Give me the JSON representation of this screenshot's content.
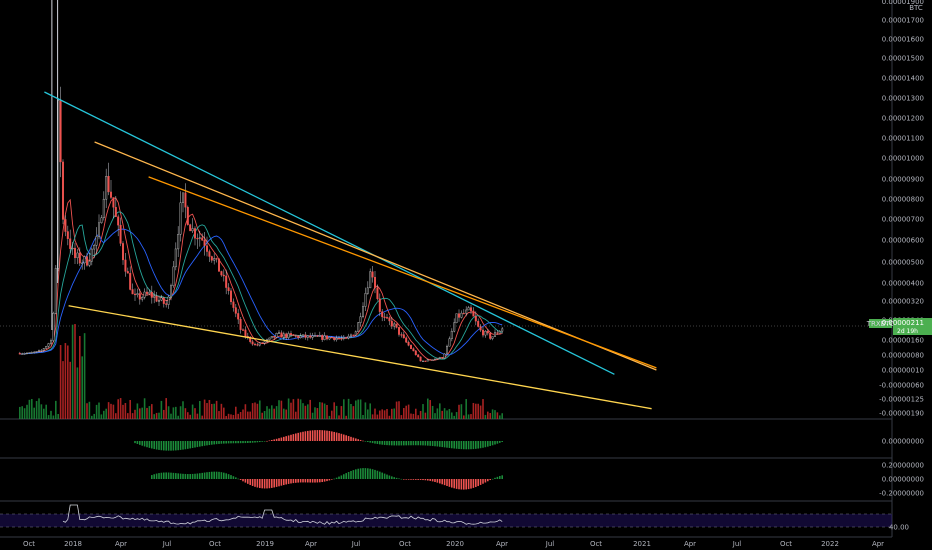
{
  "chart_data": {
    "type": "candlestick",
    "axis_unit": "BTC",
    "price_ticks": [
      "0.00001700",
      "0.00001600",
      "0.00001500",
      "0.00001400",
      "0.00001300",
      "0.00001200",
      "0.00001100",
      "0.00001000",
      "0.00000900",
      "0.00000800",
      "0.00000700",
      "0.00000600",
      "0.00000500",
      "0.00000400",
      "0.00000320",
      "0.00000240",
      "0.00000160",
      "0.00000080",
      "0.00000010",
      "-0.00000060",
      "-0.00000125",
      "-0.00000190"
    ],
    "top_tick_partial": "0.00001900",
    "current_price": {
      "symbol": "TRXBTC",
      "value": "0.00000211",
      "countdown": "2d 19h"
    },
    "osc1_tick": "0.00000000",
    "osc2_ticks": [
      "0.20000000",
      "0.00000000",
      "-0.20000000"
    ],
    "rsi_tick": "40.00",
    "time_labels": [
      "Oct",
      "2018",
      "Apr",
      "Jul",
      "Oct",
      "2019",
      "Apr",
      "Jul",
      "Oct",
      "2020",
      "Apr",
      "Jul",
      "Oct",
      "2021",
      "Apr",
      "Jul",
      "Oct",
      "2022",
      "Apr"
    ],
    "price_series": [
      {
        "t": 0,
        "p": 9e-07
      },
      {
        "t": 0.25,
        "p": 1e-06
      },
      {
        "t": 0.5,
        "p": 1.6e-06
      },
      {
        "t": 0.6,
        "p": 5e-06
      },
      {
        "t": 0.65,
        "p": 1.3e-05
      },
      {
        "t": 0.75,
        "p": 7e-06
      },
      {
        "t": 1.0,
        "p": 5.2e-06
      },
      {
        "t": 1.25,
        "p": 5e-06
      },
      {
        "t": 1.5,
        "p": 6e-06
      },
      {
        "t": 1.65,
        "p": 9e-06
      },
      {
        "t": 1.75,
        "p": 8.5e-06
      },
      {
        "t": 2.0,
        "p": 5.5e-06
      },
      {
        "t": 2.25,
        "p": 3.3e-06
      },
      {
        "t": 2.6,
        "p": 3.5e-06
      },
      {
        "t": 3.0,
        "p": 3e-06
      },
      {
        "t": 3.3,
        "p": 8e-06
      },
      {
        "t": 3.5,
        "p": 6.5e-06
      },
      {
        "t": 3.75,
        "p": 6e-06
      },
      {
        "t": 4.1,
        "p": 4.5e-06
      },
      {
        "t": 4.5,
        "p": 2e-06
      },
      {
        "t": 4.8,
        "p": 1.3e-06
      },
      {
        "t": 5.25,
        "p": 1.8e-06
      },
      {
        "t": 6.0,
        "p": 1.7e-06
      },
      {
        "t": 6.5,
        "p": 1.7e-06
      },
      {
        "t": 6.75,
        "p": 1.6e-06
      },
      {
        "t": 7.0,
        "p": 2e-06
      },
      {
        "t": 7.3,
        "p": 4.7e-06
      },
      {
        "t": 7.5,
        "p": 2.5e-06
      },
      {
        "t": 7.75,
        "p": 2.2e-06
      },
      {
        "t": 8.0,
        "p": 1.5e-06
      },
      {
        "t": 8.3,
        "p": 5e-07
      },
      {
        "t": 8.75,
        "p": 7e-07
      },
      {
        "t": 9.0,
        "p": 2.5e-06
      },
      {
        "t": 9.3,
        "p": 2.8e-06
      },
      {
        "t": 9.5,
        "p": 2e-06
      },
      {
        "t": 9.75,
        "p": 1.7e-06
      },
      {
        "t": 10.0,
        "p": 2.1e-06
      }
    ],
    "trendlines": [
      {
        "color": "#26c6da",
        "from": {
          "t": 0.35,
          "p": 1.33e-05
        },
        "to": {
          "t": 12.4,
          "p": -1e-07
        }
      },
      {
        "color": "#ffb74d",
        "from": {
          "t": 1.45,
          "p": 1.08e-05
        },
        "to": {
          "t": 13.3,
          "p": 1e-07
        }
      },
      {
        "color": "#ff9800",
        "from": {
          "t": 2.6,
          "p": 9.1e-06
        },
        "to": {
          "t": 13.3,
          "p": 2e-07
        }
      },
      {
        "color": "#ffd54f",
        "from": {
          "t": 0.9,
          "p": 3e-06
        },
        "to": {
          "t": 13.2,
          "p": -1.7e-06
        }
      }
    ]
  }
}
